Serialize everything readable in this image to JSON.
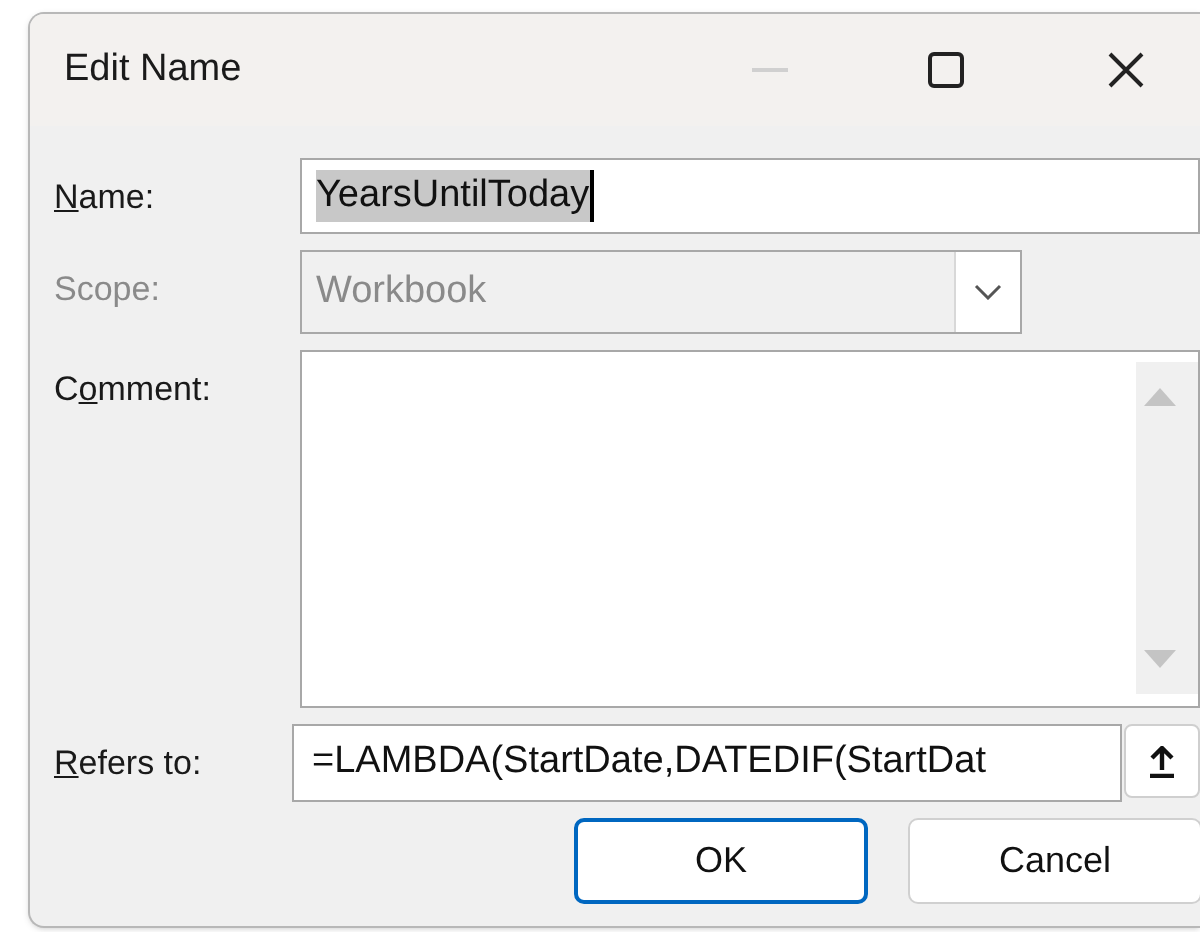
{
  "window": {
    "title": "Edit Name",
    "minimize_disabled": true
  },
  "fields": [
    {
      "kind": "text",
      "access_key": "N",
      "label_after": "ame:",
      "value": "YearsUntilToday",
      "selected": true,
      "disabled": false
    },
    {
      "kind": "combo",
      "label_before": "Scope:",
      "value": "Workbook",
      "disabled": true
    },
    {
      "kind": "memo",
      "label_before": "C",
      "access_key": "o",
      "label_after": "mment:",
      "disabled": false
    },
    {
      "kind": "ref",
      "access_key": "R",
      "label_after": "efers to:",
      "value": "=LAMBDA(StartDate,DATEDIF(StartDat",
      "disabled": false
    }
  ],
  "buttons": [
    {
      "label": "OK",
      "default": true
    },
    {
      "label": "Cancel",
      "default": false
    }
  ]
}
